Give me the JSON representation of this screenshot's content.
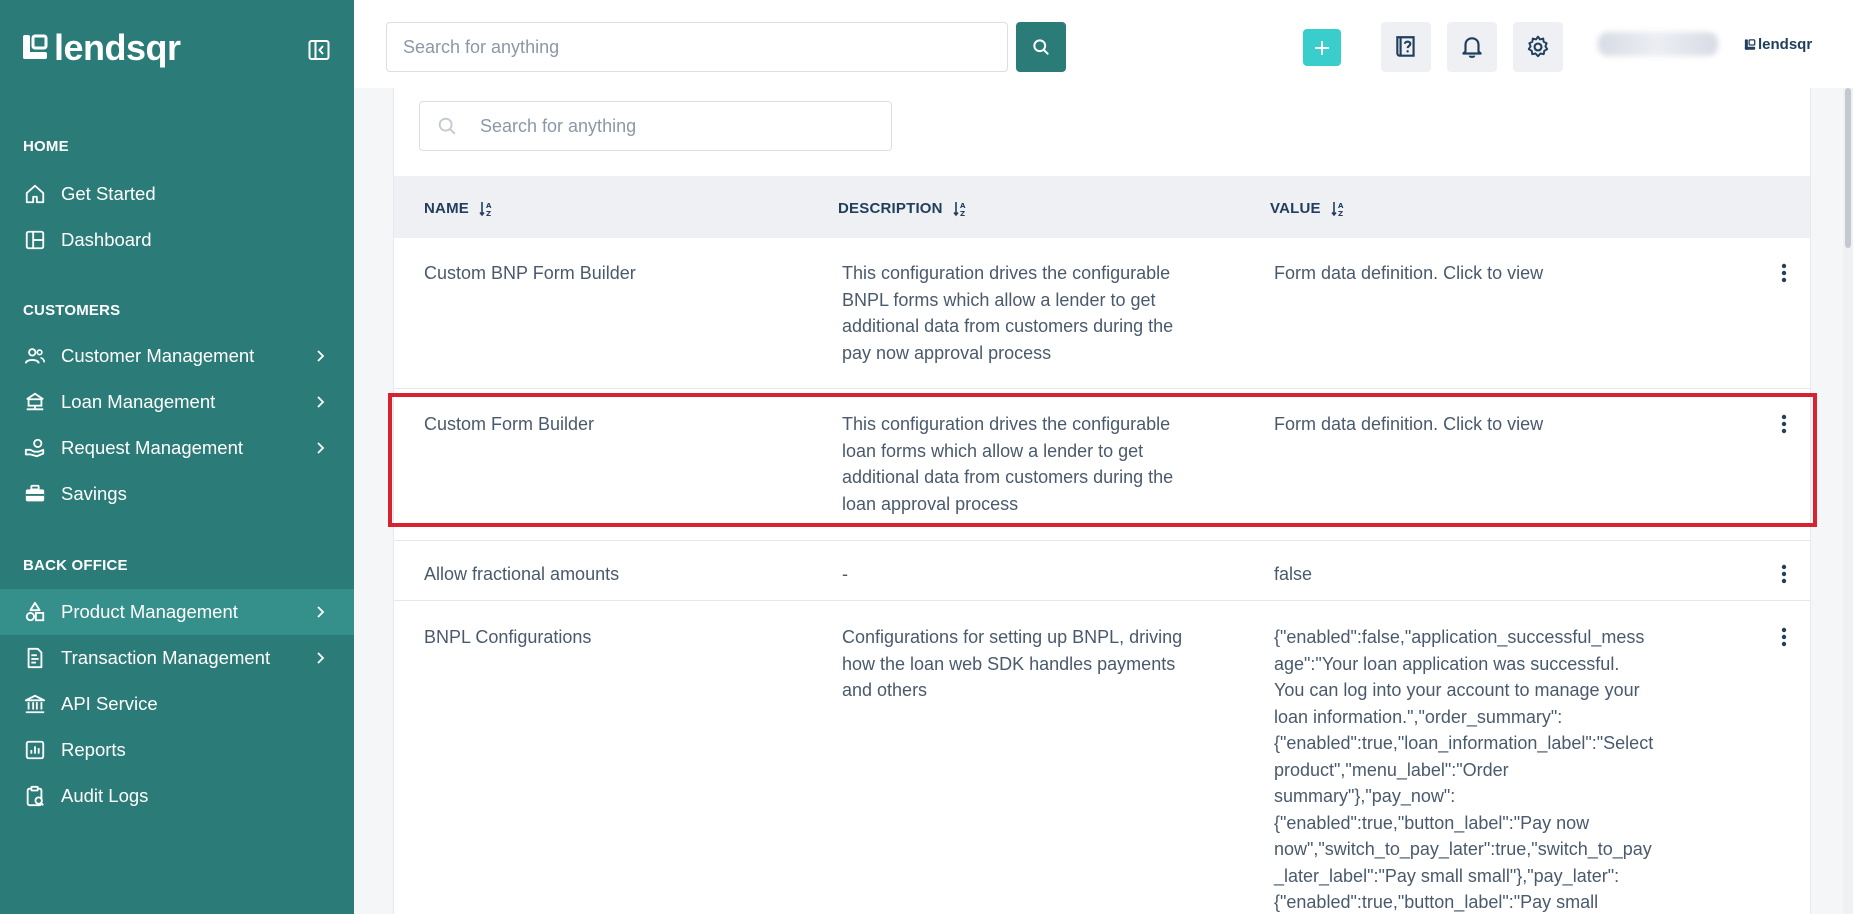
{
  "brand": {
    "name": "lendsqr"
  },
  "sidebar": {
    "sections": [
      {
        "title": "HOME",
        "items": [
          {
            "label": "Get Started",
            "icon": "home-icon"
          },
          {
            "label": "Dashboard",
            "icon": "dashboard-icon"
          }
        ]
      },
      {
        "title": "CUSTOMERS",
        "items": [
          {
            "label": "Customer Management",
            "icon": "users-icon",
            "has_submenu": true
          },
          {
            "label": "Loan Management",
            "icon": "bank-icon",
            "has_submenu": true
          },
          {
            "label": "Request Management",
            "icon": "hand-money-icon",
            "has_submenu": true
          },
          {
            "label": "Savings",
            "icon": "briefcase-icon"
          }
        ]
      },
      {
        "title": "BACK OFFICE",
        "items": [
          {
            "label": "Product Management",
            "icon": "product-icon",
            "has_submenu": true,
            "active": true
          },
          {
            "label": "Transaction Management",
            "icon": "transaction-icon",
            "has_submenu": true
          },
          {
            "label": "API Service",
            "icon": "institution-icon"
          },
          {
            "label": "Reports",
            "icon": "report-icon"
          },
          {
            "label": "Audit Logs",
            "icon": "clipboard-icon"
          }
        ]
      }
    ]
  },
  "topbar": {
    "search_placeholder": "Search for anything",
    "org_logo_text": "lendsqr"
  },
  "table": {
    "search_placeholder": "Search for anything",
    "columns": [
      "NAME",
      "DESCRIPTION",
      "VALUE"
    ],
    "rows": [
      {
        "name": "Custom BNP Form Builder",
        "description": "This configuration drives the configurable BNPL forms which allow a lender to get additional data from customers during the pay now approval process",
        "value": "Form data definition. Click to view"
      },
      {
        "name": "Custom Form Builder",
        "description": "This configuration drives the configurable loan forms which allow a lender to get additional data from customers during the loan approval process",
        "value": "Form data definition. Click to view"
      },
      {
        "name": "Allow fractional amounts",
        "description": "-",
        "value": "false"
      },
      {
        "name": "BNPL Configurations",
        "description": "Configurations for setting up BNPL, driving how the loan web SDK handles payments and others",
        "value": "{\"enabled\":false,\"application_successful_message\":\"Your loan application was successful. You can log into your account to manage your loan information.\",\"order_summary\":{\"enabled\":true,\"loan_information_label\":\"Select product\",\"menu_label\":\"Order summary\"},\"pay_now\":{\"enabled\":true,\"button_label\":\"Pay now now\",\"switch_to_pay_later\":true,\"switch_to_pay_later_label\":\"Pay small small\"},\"pay_later\":{\"enabled\":true,\"button_label\":\"Pay small"
      }
    ]
  },
  "colors": {
    "sidebar_bg": "#2b7c78",
    "sidebar_active": "#35908b",
    "accent_teal": "#39cdcc",
    "highlight_red": "#d62231",
    "text_primary": "#213f5d"
  }
}
